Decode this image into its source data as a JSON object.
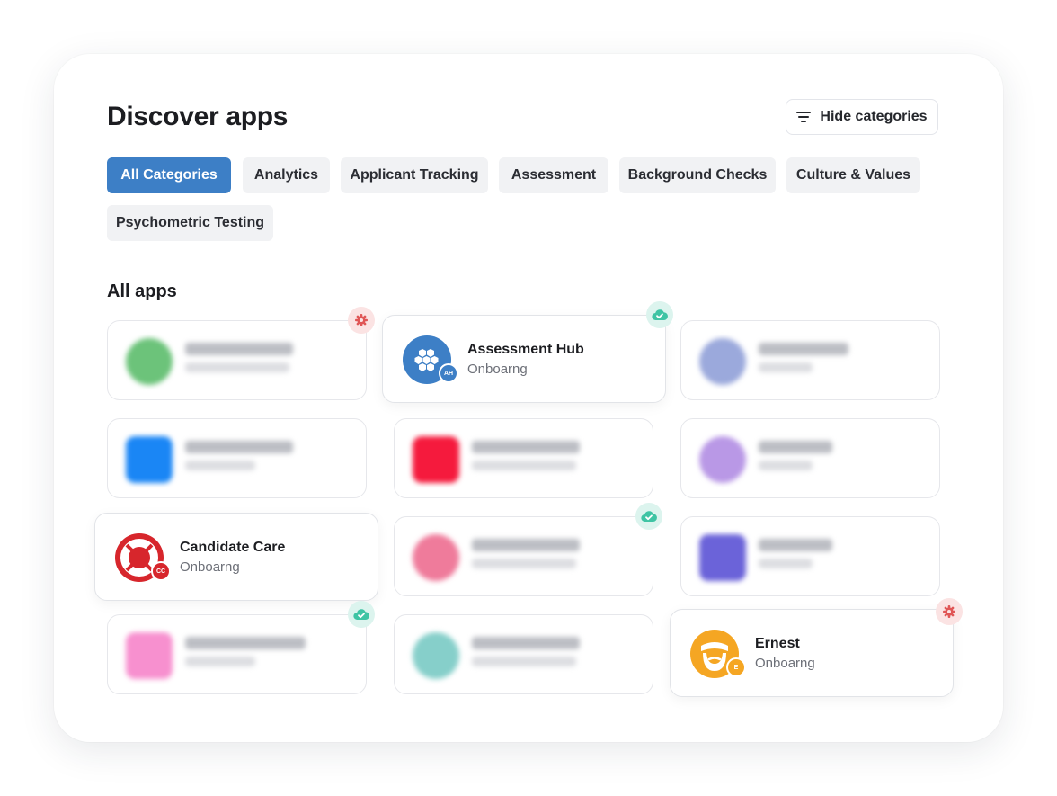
{
  "header": {
    "title": "Discover apps",
    "hide_button_label": "Hide categories",
    "hide_button_icon": "filter-lines-icon"
  },
  "categories": [
    {
      "label": "All Categories",
      "active": true
    },
    {
      "label": "Analytics",
      "active": false
    },
    {
      "label": "Applicant Tracking",
      "active": false
    },
    {
      "label": "Assessment",
      "active": false
    },
    {
      "label": "Background Checks",
      "active": false
    },
    {
      "label": "Culture & Values",
      "active": false
    },
    {
      "label": "Psychometric Testing",
      "active": false
    }
  ],
  "section_title": "All apps",
  "apps": {
    "assessment_hub": {
      "name": "Assessment Hub",
      "category": "Onboarng",
      "badge": "AH",
      "status": "installed-cloud-icon"
    },
    "candidate_care": {
      "name": "Candidate Care",
      "category": "Onboarng",
      "badge": "CC",
      "status": "installed-cloud-icon"
    },
    "ernest": {
      "name": "Ernest",
      "category": "Onboarng",
      "badge": "E",
      "status": "settings-gear-icon"
    }
  },
  "colors": {
    "accent": "#3d7fc6",
    "gear_badge": "#e05656",
    "cloud_badge": "#3fc4a4",
    "assessment_hub_logo": "#3d7fc6",
    "candidate_care_logo": "#d7262c",
    "ernest_logo": "#f5a623"
  }
}
